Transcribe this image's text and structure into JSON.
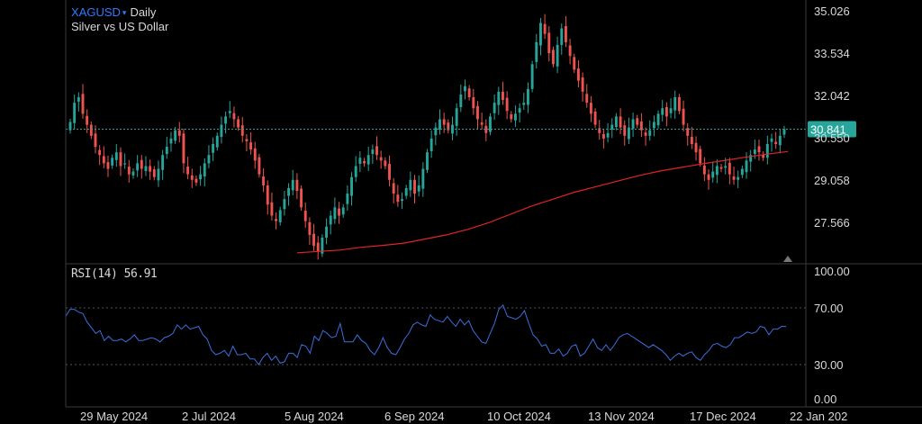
{
  "header": {
    "symbol": "XAGUSD",
    "caret": "▾",
    "timeframe": "Daily",
    "subtitle": "Silver vs US Dollar"
  },
  "rsi_header": {
    "label": "RSI(14)",
    "value": "56.91"
  },
  "price_badge": "30.841",
  "colors": {
    "background": "#000000",
    "up_candle": "#26a69a",
    "down_candle": "#ef5350",
    "moving_average": "#e02424",
    "rsi_line": "#3b6fdc",
    "price_line": "#26a69a",
    "symbol": "#2f7bff"
  },
  "chart_data": [
    {
      "type": "candlestick",
      "y_ticks": [
        "35.026",
        "33.534",
        "32.042",
        "30.550",
        "29.058",
        "27.566"
      ],
      "ylim": [
        26.05,
        35.4
      ],
      "x_ticks": [
        "29 May 2024",
        "2 Jul 2024",
        "5 Aug 2024",
        "6 Sep 2024",
        "10 Oct 2024",
        "13 Nov 2024",
        "17 Dec 2024",
        "22 Jan 202"
      ],
      "last_price": 30.841,
      "close_series": [
        31.1,
        31.8,
        32.0,
        31.4,
        31.0,
        30.6,
        30.2,
        29.9,
        29.6,
        29.4,
        29.8,
        30.0,
        29.5,
        29.6,
        29.2,
        29.3,
        29.6,
        29.4,
        29.5,
        29.3,
        29.1,
        29.4,
        29.9,
        30.2,
        30.5,
        30.8,
        30.6,
        29.6,
        29.2,
        29.0,
        28.9,
        29.2,
        29.6,
        29.9,
        30.3,
        30.6,
        31.0,
        31.3,
        31.5,
        31.2,
        30.9,
        30.6,
        30.4,
        30.1,
        29.7,
        29.2,
        28.8,
        28.1,
        27.7,
        27.5,
        27.9,
        28.3,
        28.7,
        29.0,
        28.6,
        28.0,
        27.5,
        27.0,
        26.6,
        26.4,
        26.9,
        27.3,
        27.7,
        28.0,
        27.7,
        28.0,
        28.5,
        29.1,
        29.5,
        29.8,
        29.6,
        29.9,
        30.1,
        29.9,
        29.7,
        29.5,
        29.0,
        28.5,
        28.2,
        28.3,
        28.7,
        29.0,
        28.5,
        28.8,
        29.4,
        30.0,
        30.5,
        30.9,
        31.2,
        31.0,
        30.8,
        31.0,
        31.6,
        32.1,
        32.4,
        32.0,
        31.6,
        31.2,
        31.0,
        30.7,
        31.3,
        31.8,
        32.2,
        31.9,
        31.5,
        31.2,
        31.4,
        31.6,
        31.8,
        32.3,
        33.2,
        34.0,
        34.7,
        34.3,
        33.6,
        33.2,
        33.9,
        34.5,
        34.0,
        33.5,
        33.0,
        32.6,
        32.2,
        31.8,
        31.4,
        31.0,
        30.7,
        30.5,
        30.7,
        31.0,
        31.3,
        30.9,
        30.6,
        30.9,
        31.2,
        31.0,
        30.8,
        30.6,
        30.8,
        31.1,
        31.4,
        31.6,
        31.3,
        31.6,
        32.0,
        31.5,
        31.0,
        30.6,
        30.3,
        30.0,
        29.6,
        29.2,
        29.0,
        29.3,
        29.5,
        29.4,
        29.5,
        29.2,
        29.0,
        29.1,
        29.4,
        29.7,
        29.9,
        30.1,
        30.0,
        29.8,
        30.3,
        30.5,
        30.3,
        30.6,
        30.841
      ],
      "series": [
        {
          "name": "",
          "kind": "ma",
          "values": [
            26.35,
            26.4,
            26.45,
            26.55,
            26.62,
            26.7,
            26.85,
            27.0,
            27.2,
            27.45,
            27.75,
            28.05,
            28.3,
            28.55,
            28.75,
            28.95,
            29.15,
            29.32,
            29.45,
            29.58,
            29.7,
            29.82,
            29.93,
            30.03
          ]
        }
      ]
    },
    {
      "type": "line",
      "title": "RSI(14)",
      "y_ticks": [
        "100.00",
        "70.00",
        "30.00",
        "0.00"
      ],
      "ylim": [
        0,
        100
      ],
      "ref_lines": [
        70,
        30
      ],
      "series": [
        {
          "name": "",
          "values": [
            64,
            69,
            69,
            67,
            66,
            60,
            56,
            52,
            54,
            47,
            50,
            47,
            47,
            48,
            46,
            48,
            51,
            47,
            47,
            48,
            49,
            48,
            46,
            49,
            50,
            52,
            58,
            55,
            58,
            55,
            56,
            57,
            51,
            48,
            40,
            37,
            38,
            40,
            36,
            43,
            37,
            37,
            38,
            34,
            34,
            30,
            35,
            38,
            33,
            36,
            31,
            32,
            38,
            38,
            35,
            44,
            43,
            38,
            50,
            47,
            54,
            52,
            49,
            50,
            59,
            46,
            46,
            46,
            51,
            47,
            45,
            40,
            37,
            42,
            49,
            42,
            38,
            37,
            42,
            48,
            52,
            58,
            60,
            58,
            57,
            65,
            62,
            61,
            60,
            64,
            60,
            57,
            62,
            58,
            61,
            54,
            50,
            46,
            45,
            52,
            59,
            69,
            72,
            64,
            63,
            62,
            64,
            68,
            59,
            51,
            48,
            43,
            44,
            38,
            38,
            41,
            36,
            38,
            43,
            44,
            36,
            38,
            43,
            48,
            42,
            40,
            44,
            40,
            44,
            49,
            51,
            52,
            50,
            48,
            46,
            44,
            42,
            44,
            42,
            40,
            37,
            33,
            36,
            38,
            36,
            38,
            39,
            35,
            33,
            37,
            40,
            44,
            45,
            43,
            42,
            44,
            49,
            49,
            51,
            53,
            52,
            53,
            57,
            56,
            51,
            55,
            55,
            57,
            56.91
          ]
        }
      ]
    }
  ]
}
